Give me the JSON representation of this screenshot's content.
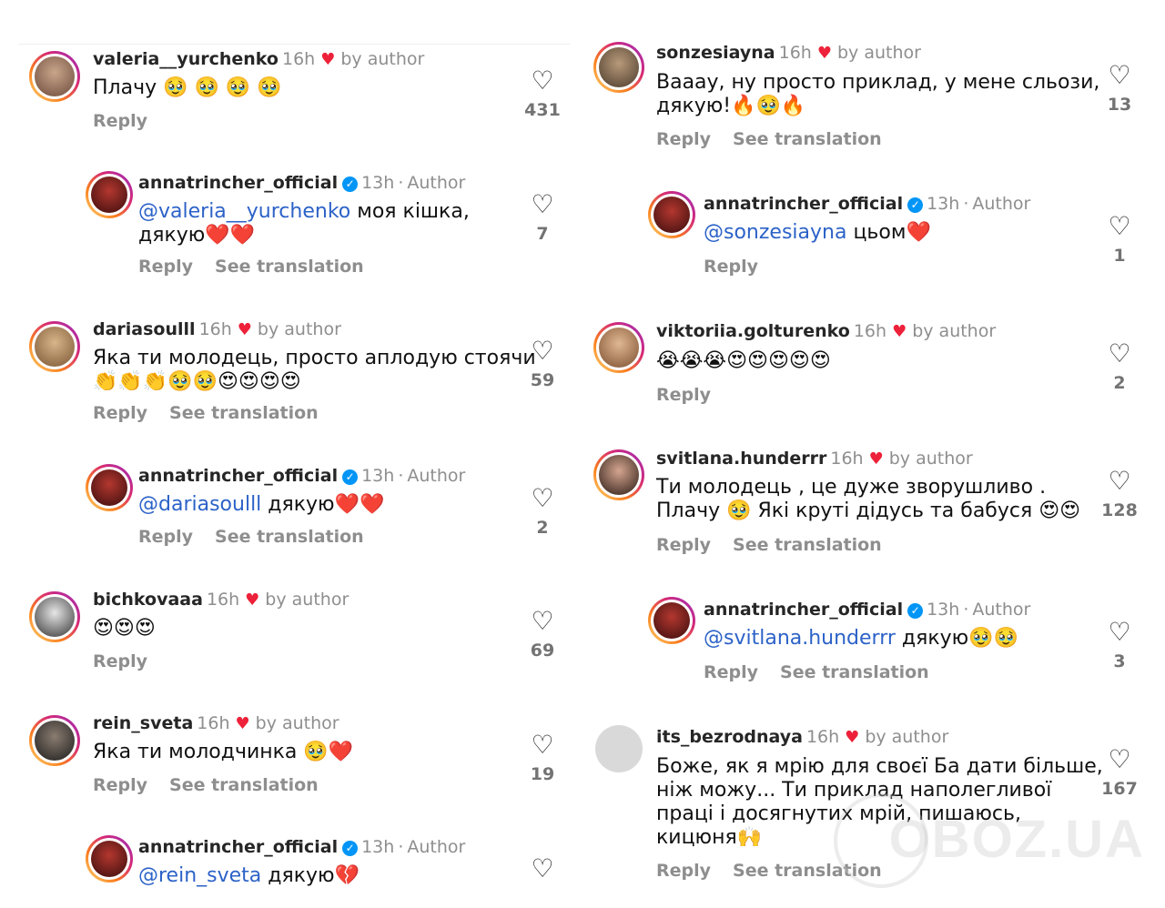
{
  "common": {
    "reply_label": "Reply",
    "see_translation_label": "See translation",
    "by_author_label": "by author",
    "author_label": "Author",
    "heart_glyph": "♥",
    "like_glyph": "♡",
    "verified_glyph": "✓",
    "dot": "·"
  },
  "left": {
    "c1": {
      "user": "valeria__yurchenko",
      "time": "16h",
      "text": "Плачу 🥹 🥹 🥹 🥹",
      "likes": "431"
    },
    "r1": {
      "user": "annatrincher_official",
      "time": "13h",
      "mention": "@valeria__yurchenko",
      "text_a": " моя кішка,",
      "text_b": "дякую❤️❤️",
      "likes": "7"
    },
    "c2": {
      "user": "dariasoulll",
      "time": "16h",
      "text_a": "Яка ти молодець, просто аплодую стоячи",
      "text_b": "👏👏👏🥹🥹😍😍😍😍",
      "likes": "59"
    },
    "r2": {
      "user": "annatrincher_official",
      "time": "13h",
      "mention": "@dariasoulll",
      "text": " дякую❤️❤️",
      "likes": "2"
    },
    "c3": {
      "user": "bichkovaaa",
      "time": "16h",
      "text": "😍😍😍",
      "likes": "69"
    },
    "c4": {
      "user": "rein_sveta",
      "time": "16h",
      "text": "Яка ти молодчинка 🥹❤️",
      "likes": "19"
    },
    "r4": {
      "user": "annatrincher_official",
      "time": "13h",
      "mention": "@rein_sveta",
      "text": " дякую💔"
    }
  },
  "right": {
    "c1": {
      "user": "sonzesiayna",
      "time": "16h",
      "text_a": "Вааау, ну просто приклад, у мене сльози,",
      "text_b": "дякую!🔥🥹🔥",
      "likes": "13"
    },
    "r1": {
      "user": "annatrincher_official",
      "time": "13h",
      "mention": "@sonzesiayna",
      "text": " цьом❤️",
      "likes": "1"
    },
    "c2": {
      "user": "viktoriia.golturenko",
      "time": "16h",
      "text": "😭😭😭😍😍😍😍😍",
      "likes": "2"
    },
    "c3": {
      "user": "svitlana.hunderrr",
      "time": "16h",
      "text_a": "Ти молодець , це дуже зворушливо .",
      "text_b": "Плачу 🥹 Які круті дідусь та бабуся 😍😍",
      "likes": "128"
    },
    "r3": {
      "user": "annatrincher_official",
      "time": "13h",
      "mention": "@svitlana.hunderrr",
      "text": " дякую🥹🥹",
      "likes": "3"
    },
    "c4": {
      "user": "its_bezrodnaya",
      "time": "16h",
      "text_a": "Боже, як я мрію для своєї Ба дати більше,",
      "text_b": "ніж можу... Ти приклад наполегливої",
      "text_c": "праці і досягнутих мрій, пишаюсь,",
      "text_d": "кицюня🙌",
      "likes": "167"
    }
  },
  "watermark": "OBOZ.UA"
}
